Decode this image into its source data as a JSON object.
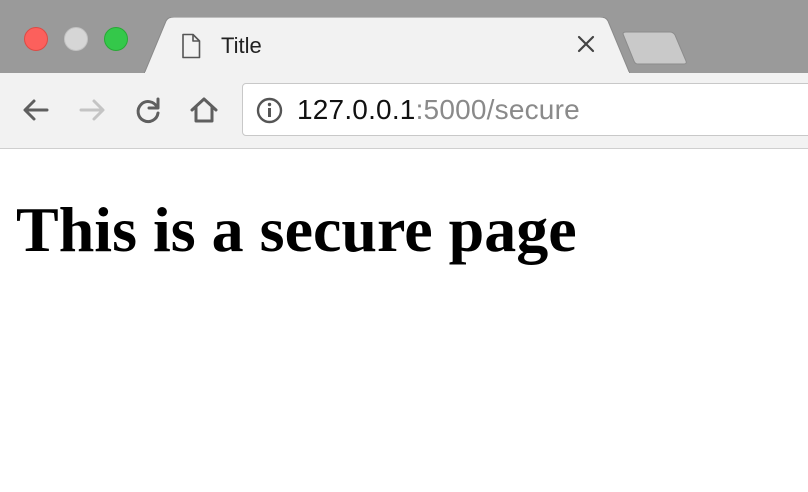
{
  "window": {
    "traffic_lights": {
      "close_color": "#fc605c",
      "minimize_color": "#d6d6d6",
      "zoom_color": "#34c84a"
    }
  },
  "tab": {
    "title": "Title",
    "icon": "page-icon",
    "close_icon": "close-icon"
  },
  "new_tab": {
    "icon": "new-tab-icon"
  },
  "toolbar": {
    "back_icon": "back-arrow-icon",
    "forward_icon": "forward-arrow-icon",
    "reload_icon": "reload-icon",
    "home_icon": "home-icon"
  },
  "address_bar": {
    "info_icon": "info-icon",
    "host": "127.0.0.1",
    "rest": ":5000/secure"
  },
  "page": {
    "heading": "This is a secure page"
  }
}
